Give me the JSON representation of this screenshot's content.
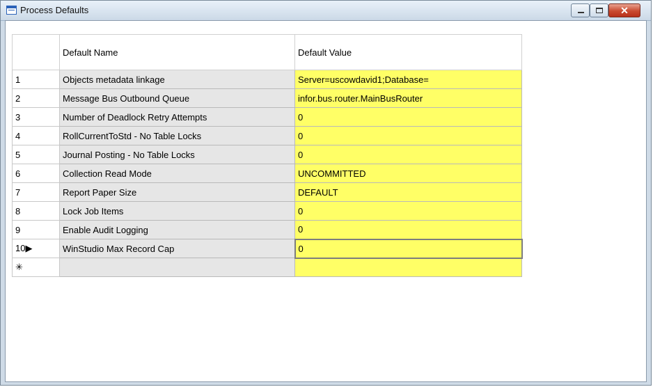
{
  "window": {
    "title": "Process Defaults",
    "icon": "grid-window-icon",
    "controls": {
      "minimize": "minimize-icon",
      "maximize": "maximize-icon",
      "close_glyph": "✕"
    }
  },
  "grid": {
    "columns": [
      "Default Name",
      "Default Value"
    ],
    "rows": [
      {
        "num": "1",
        "name": "Objects metadata linkage",
        "value": "Server=uscowdavid1;Database="
      },
      {
        "num": "2",
        "name": "Message Bus Outbound Queue",
        "value": "infor.bus.router.MainBusRouter"
      },
      {
        "num": "3",
        "name": "Number of Deadlock Retry Attempts",
        "value": "0"
      },
      {
        "num": "4",
        "name": "RollCurrentToStd - No Table Locks",
        "value": "0"
      },
      {
        "num": "5",
        "name": "Journal Posting - No Table Locks",
        "value": "0"
      },
      {
        "num": "6",
        "name": "Collection Read Mode",
        "value": "UNCOMMITTED"
      },
      {
        "num": "7",
        "name": "Report Paper Size",
        "value": "DEFAULT"
      },
      {
        "num": "8",
        "name": "Lock Job Items",
        "value": "0"
      },
      {
        "num": "9",
        "name": "Enable Audit Logging",
        "value": "0"
      },
      {
        "num": "10▶",
        "name": "WinStudio Max Record Cap",
        "value": "0"
      }
    ],
    "new_row_marker": "✳",
    "colors": {
      "value_bg": "#ffff66",
      "name_bg": "#e6e6e6"
    }
  }
}
